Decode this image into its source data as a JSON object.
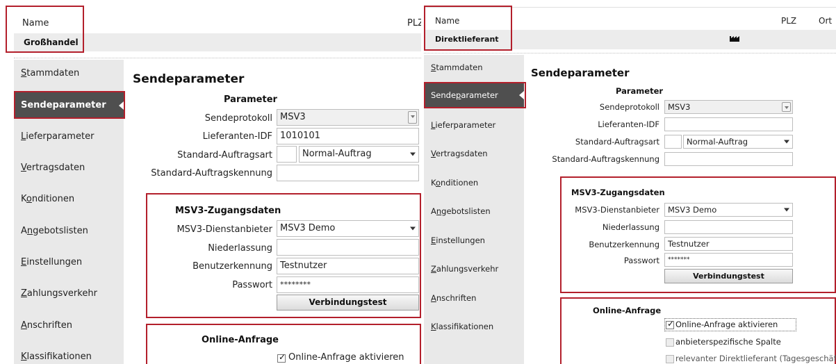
{
  "left": {
    "header": {
      "name_label": "Name",
      "plz_label": "PLZ",
      "name_value": "Großhandel"
    },
    "nav": [
      {
        "label": "Stammdaten",
        "u": "S",
        "rest": "tammdaten"
      },
      {
        "label": "Sendeparameter",
        "active": true
      },
      {
        "label": "Lieferparameter",
        "u": "L",
        "rest": "ieferparameter"
      },
      {
        "label": "Vertragsdaten",
        "u": "V",
        "rest": "ertragsdaten"
      },
      {
        "label": "Konditionen",
        "pre": "K",
        "u": "o",
        "rest": "nditionen"
      },
      {
        "label": "Angebotslisten",
        "pre": "A",
        "u": "n",
        "rest": "gebotslisten"
      },
      {
        "label": "Einstellungen",
        "u": "E",
        "rest": "instellungen"
      },
      {
        "label": "Zahlungsverkehr",
        "u": "Z",
        "rest": "ahlungsverkehr"
      },
      {
        "label": "Anschriften",
        "u": "A",
        "rest": "nschriften"
      },
      {
        "label": "Klassifikationen",
        "u": "K",
        "rest": "lassifikationen"
      }
    ],
    "title": "Sendeparameter",
    "parameter_heading": "Parameter",
    "fields": {
      "sendeprotokoll_label": "Sendeprotokoll",
      "sendeprotokoll_value": "MSV3",
      "lieferanten_idf_label": "Lieferanten-IDF",
      "lieferanten_idf_value": "1010101",
      "auftragsart_label": "Standard-Auftragsart",
      "auftragsart_value": "Normal-Auftrag",
      "auftragskennung_label": "Standard-Auftragskennung",
      "auftragskennung_value": ""
    },
    "msv3": {
      "heading": "MSV3-Zugangsdaten",
      "dienstanbieter_label": "MSV3-Dienstanbieter",
      "dienstanbieter_value": "MSV3 Demo",
      "niederlassung_label": "Niederlassung",
      "niederlassung_value": "",
      "benutzer_label": "Benutzerkennung",
      "benutzer_value": "Testnutzer",
      "passwort_label": "Passwort",
      "passwort_value": "********",
      "test_button": "Verbindungstest"
    },
    "online": {
      "heading": "Online-Anfrage",
      "aktivieren_label": "Online-Anfrage aktivieren",
      "aktivieren_checked": true
    }
  },
  "right": {
    "header": {
      "name_label": "Name",
      "plz_label": "PLZ",
      "ort_label": "Ort",
      "name_value": "Direktlieferant"
    },
    "nav": [
      {
        "label": "Stammdaten",
        "u": "S",
        "rest": "tammdaten"
      },
      {
        "label": "Sendeparameter",
        "pre": "Sende",
        "u": "p",
        "rest": "arameter",
        "active": true
      },
      {
        "label": "Lieferparameter",
        "u": "L",
        "rest": "ieferparameter"
      },
      {
        "label": "Vertragsdaten",
        "u": "V",
        "rest": "ertragsdaten"
      },
      {
        "label": "Konditionen",
        "pre": "K",
        "u": "o",
        "rest": "nditionen"
      },
      {
        "label": "Angebotslisten",
        "pre": "A",
        "u": "n",
        "rest": "gebotslisten"
      },
      {
        "label": "Einstellungen",
        "u": "E",
        "rest": "instellungen"
      },
      {
        "label": "Zahlungsverkehr",
        "u": "Z",
        "rest": "ahlungsverkehr"
      },
      {
        "label": "Anschriften",
        "u": "A",
        "rest": "nschriften"
      },
      {
        "label": "Klassifikationen",
        "u": "K",
        "rest": "lassifikationen"
      }
    ],
    "title": "Sendeparameter",
    "parameter_heading": "Parameter",
    "fields": {
      "sendeprotokoll_label": "Sendeprotokoll",
      "sendeprotokoll_value": "MSV3",
      "lieferanten_idf_label": "Lieferanten-IDF",
      "lieferanten_idf_value": "",
      "auftragsart_label": "Standard-Auftragsart",
      "auftragsart_value": "Normal-Auftrag",
      "auftragskennung_label": "Standard-Auftragskennung",
      "auftragskennung_value": ""
    },
    "msv3": {
      "heading": "MSV3-Zugangsdaten",
      "dienstanbieter_label": "MSV3-Dienstanbieter",
      "dienstanbieter_value": "MSV3 Demo",
      "niederlassung_label": "Niederlassung",
      "niederlassung_value": "",
      "benutzer_label": "Benutzerkennung",
      "benutzer_value": "Testnutzer",
      "passwort_label": "Passwort",
      "passwort_value": "*******",
      "test_button": "Verbindungstest"
    },
    "online": {
      "heading": "Online-Anfrage",
      "aktivieren_label": "Online-Anfrage aktivieren",
      "aktivieren_checked": true,
      "spalte_label": "anbieterspezifische Spalte",
      "spalte_checked": false,
      "relevant_label": "relevanter Direktlieferant (Tagesgeschäft)",
      "relevant_checked": false
    }
  },
  "colors": {
    "highlight_red": "#b31f2b",
    "nav_active_bg": "#4f4f4f",
    "nav_bg": "#e9e9e9"
  }
}
